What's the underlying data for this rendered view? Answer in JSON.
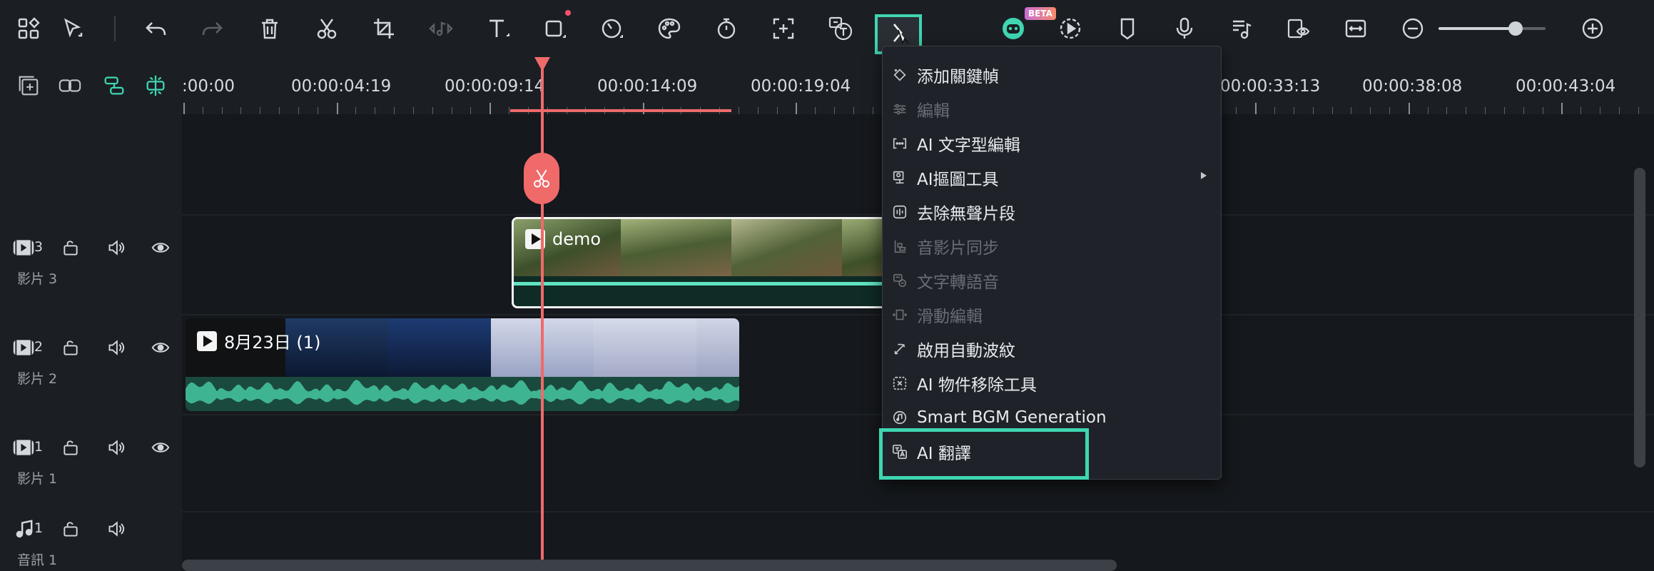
{
  "colors": {
    "accent": "#3fd6b1",
    "playhead": "#f06a6a",
    "menu_bg": "#1f2329",
    "clip_border": "#f2f2f2",
    "waveform": "#2bb48c"
  },
  "toolbar": {
    "beta_badge": "BETA",
    "icons": [
      "layout-icon",
      "select-tool-icon",
      "undo-icon",
      "redo-icon",
      "delete-icon",
      "cut-icon",
      "crop-icon",
      "audio-edit-icon",
      "text-icon",
      "shape-icon",
      "speed-icon",
      "color-icon",
      "timer-icon",
      "ai-expand-icon",
      "speech-to-text-icon",
      "split-icon",
      "ai-copilot-icon",
      "render-preview-icon",
      "marker-icon",
      "voiceover-icon",
      "audio-stretch-icon",
      "preview-eye-icon",
      "fit-icon",
      "zoom-out-icon",
      "zoom-in-icon"
    ],
    "zoom_level": 0.72
  },
  "left_panel": {
    "icons": [
      "add-track-icon",
      "link-icon",
      "magnetic-icon",
      "snap-icon"
    ]
  },
  "tracks": [
    {
      "number": "3",
      "label": "影片 3",
      "type": "video"
    },
    {
      "number": "2",
      "label": "影片 2",
      "type": "video"
    },
    {
      "number": "1",
      "label": "影片 1",
      "type": "video"
    },
    {
      "number": "1",
      "label": "音訊 1",
      "type": "audio"
    }
  ],
  "ruler": {
    "labels": [
      ":00:00",
      "00:00:04:19",
      "00:00:09:14",
      "00:00:14:09",
      "00:00:19:04",
      "00:00:33:13",
      "00:00:38:08",
      "00:00:43:04"
    ]
  },
  "clips": {
    "demo": {
      "title": "demo"
    },
    "aug23": {
      "title": "8月23日 (1)"
    }
  },
  "context_menu": {
    "items": [
      {
        "label": "添加關鍵幀",
        "enabled": true,
        "icon": "keyframe-icon"
      },
      {
        "label": "編輯",
        "enabled": false,
        "icon": "adjust-icon"
      },
      {
        "label": "AI 文字型編輯",
        "enabled": true,
        "icon": "ai-text-edit-icon"
      },
      {
        "label": "AI摳圖工具",
        "enabled": true,
        "icon": "ai-cutout-icon",
        "submenu": true
      },
      {
        "label": "去除無聲片段",
        "enabled": true,
        "icon": "silence-removal-icon"
      },
      {
        "label": "音影片同步",
        "enabled": false,
        "icon": "sync-icon"
      },
      {
        "label": "文字轉語音",
        "enabled": false,
        "icon": "text-to-speech-icon"
      },
      {
        "label": "滑動編輯",
        "enabled": false,
        "icon": "slide-edit-icon"
      },
      {
        "label": "啟用自動波紋",
        "enabled": true,
        "icon": "auto-ripple-icon"
      },
      {
        "label": "AI 物件移除工具",
        "enabled": true,
        "icon": "object-removal-icon"
      },
      {
        "label": "Smart BGM Generation",
        "enabled": true,
        "icon": "bgm-icon"
      },
      {
        "label": "AI 翻譯",
        "enabled": true,
        "icon": "translate-icon",
        "highlighted": true
      }
    ]
  }
}
